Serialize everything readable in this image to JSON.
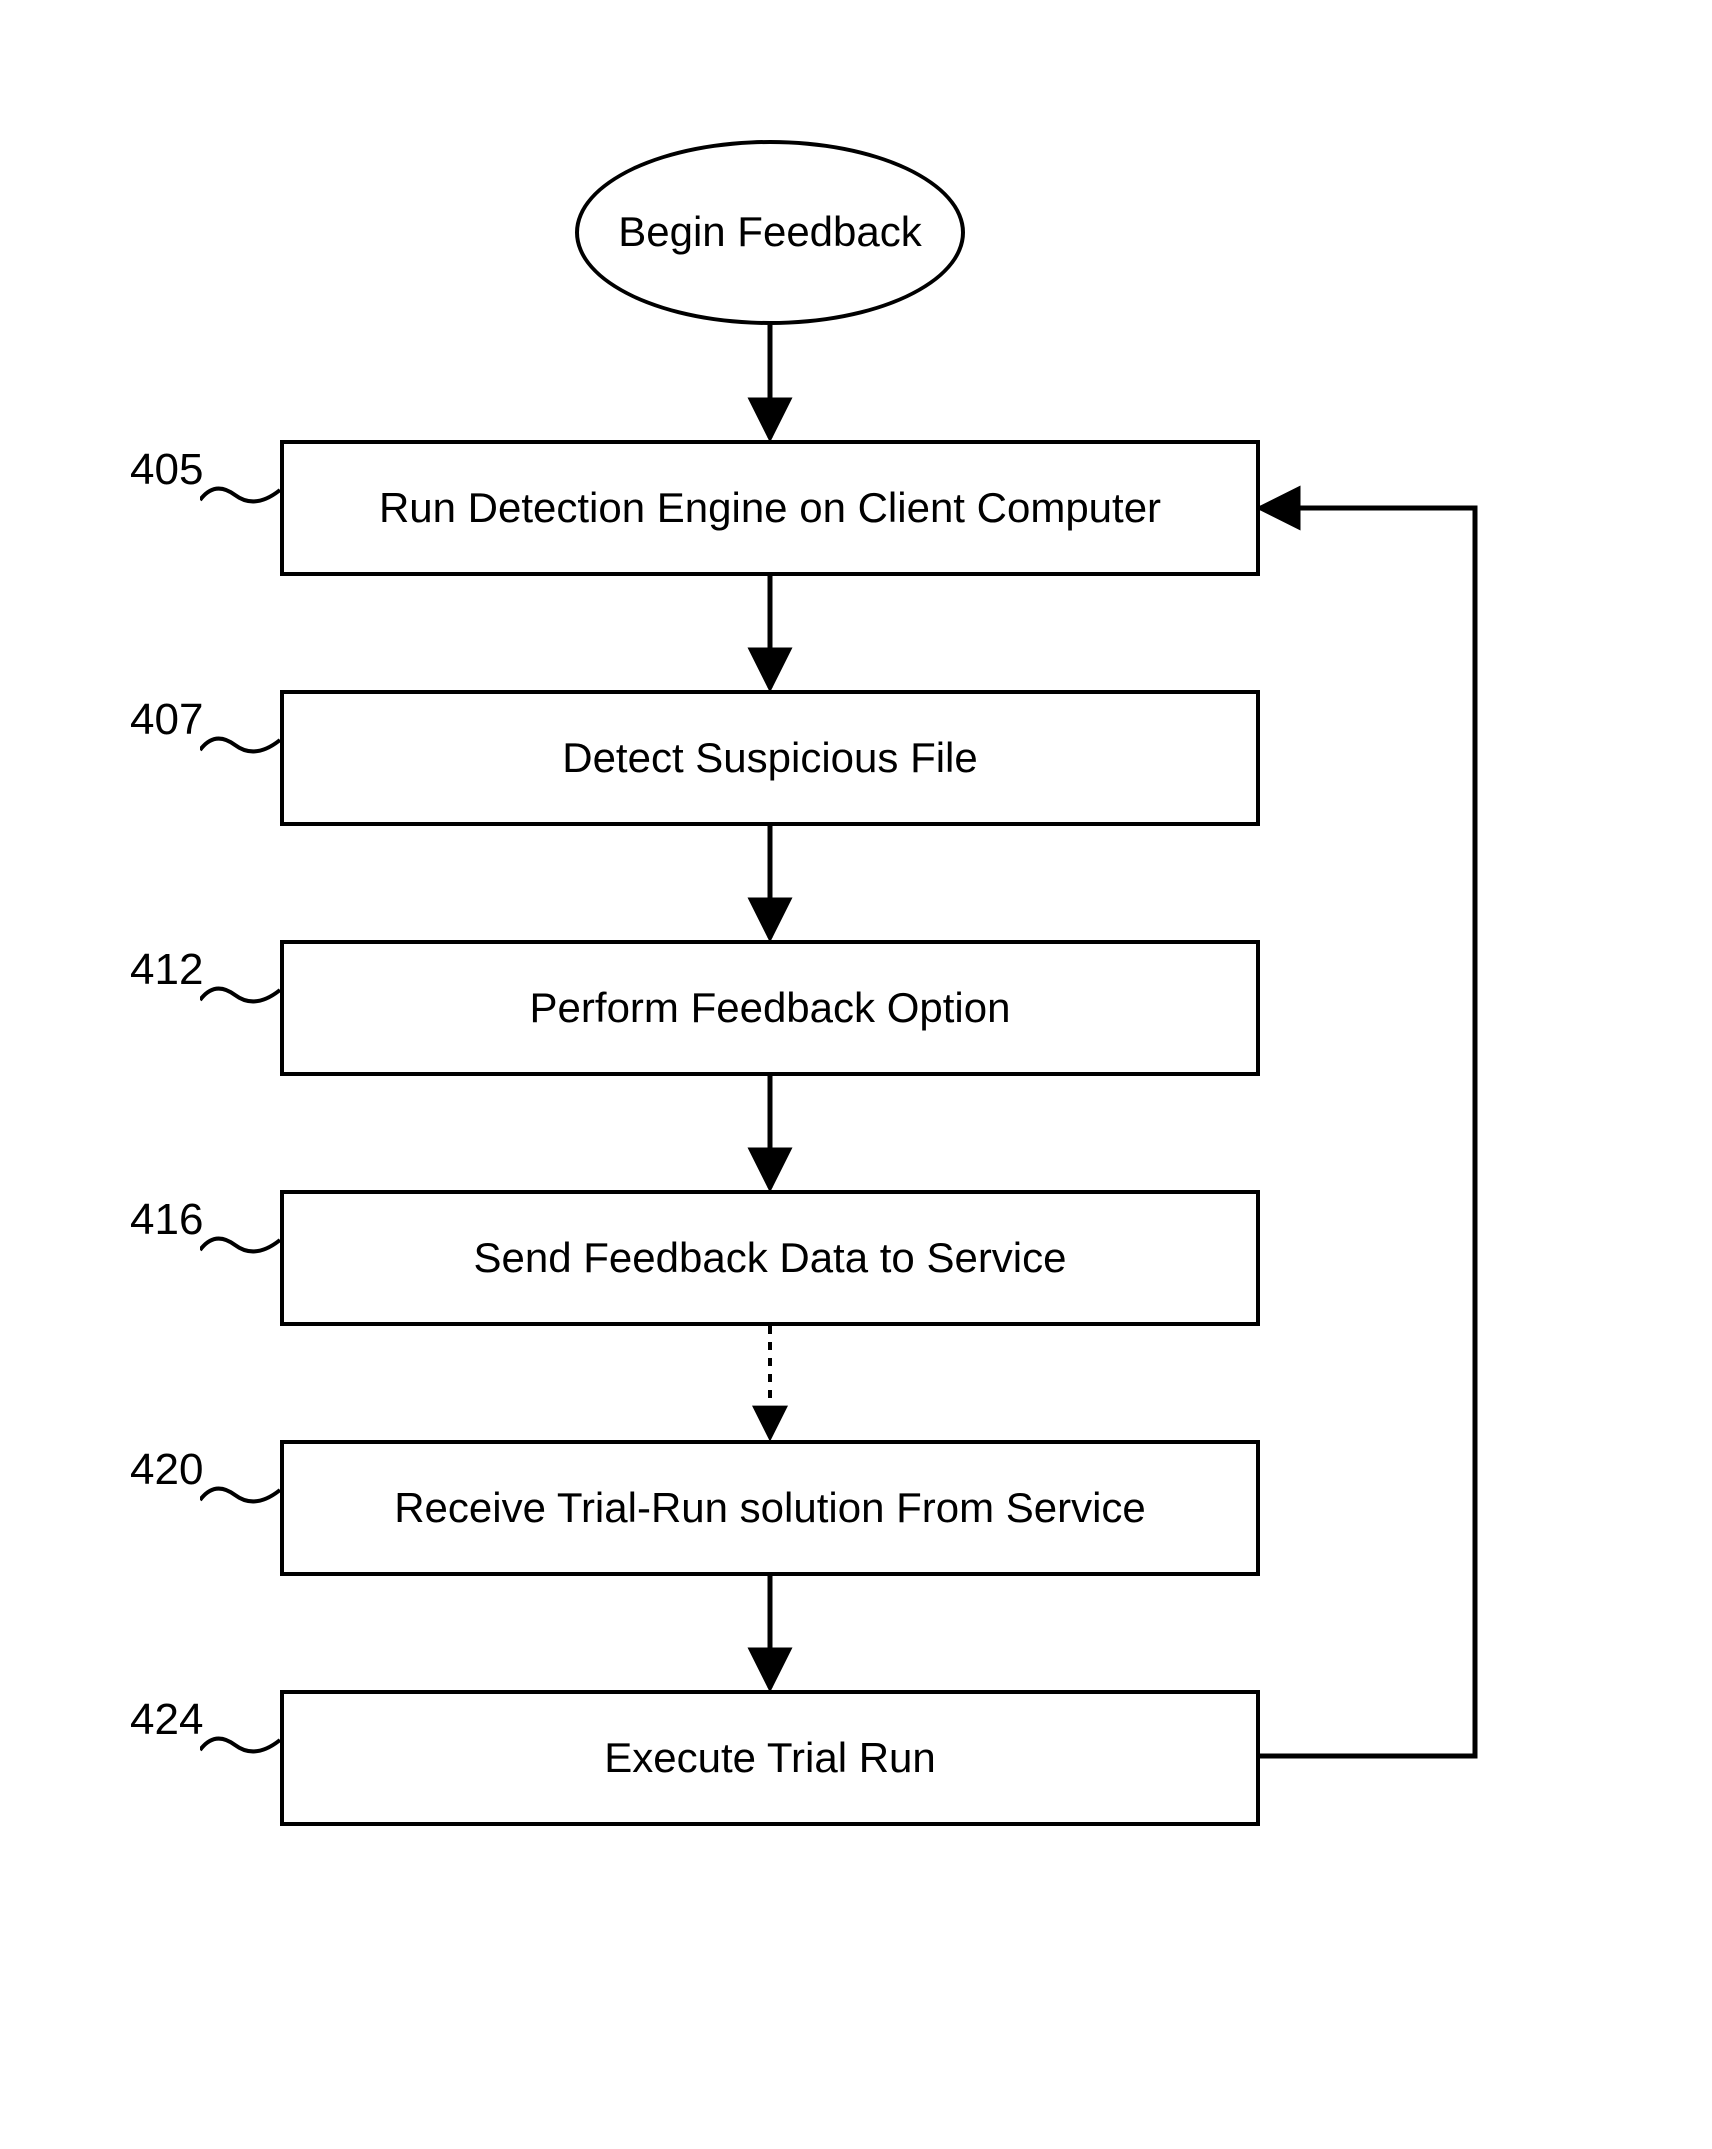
{
  "chart_data": {
    "type": "flowchart",
    "title": "",
    "nodes": [
      {
        "id": "start",
        "shape": "ellipse",
        "label": "Begin Feedback"
      },
      {
        "id": "n405",
        "shape": "rect",
        "label": "Run Detection Engine on Client Computer",
        "ref": "405"
      },
      {
        "id": "n407",
        "shape": "rect",
        "label": "Detect Suspicious File",
        "ref": "407"
      },
      {
        "id": "n412",
        "shape": "rect",
        "label": "Perform Feedback Option",
        "ref": "412"
      },
      {
        "id": "n416",
        "shape": "rect",
        "label": "Send Feedback Data to Service",
        "ref": "416"
      },
      {
        "id": "n420",
        "shape": "rect",
        "label": "Receive Trial-Run solution From Service",
        "ref": "420"
      },
      {
        "id": "n424",
        "shape": "rect",
        "label": "Execute Trial Run",
        "ref": "424"
      }
    ],
    "edges": [
      {
        "from": "start",
        "to": "n405",
        "style": "solid"
      },
      {
        "from": "n405",
        "to": "n407",
        "style": "solid"
      },
      {
        "from": "n407",
        "to": "n412",
        "style": "solid"
      },
      {
        "from": "n412",
        "to": "n416",
        "style": "solid"
      },
      {
        "from": "n416",
        "to": "n420",
        "style": "dashed"
      },
      {
        "from": "n420",
        "to": "n424",
        "style": "solid"
      },
      {
        "from": "n424",
        "to": "n405",
        "style": "solid",
        "note": "loop-back"
      }
    ]
  },
  "diagram": {
    "start_label": "Begin Feedback",
    "steps": {
      "s405": {
        "ref": "405",
        "text": "Run Detection Engine on Client Computer"
      },
      "s407": {
        "ref": "407",
        "text": "Detect Suspicious File"
      },
      "s412": {
        "ref": "412",
        "text": "Perform Feedback Option"
      },
      "s416": {
        "ref": "416",
        "text": "Send Feedback Data to Service"
      },
      "s420": {
        "ref": "420",
        "text": "Receive Trial-Run solution From Service"
      },
      "s424": {
        "ref": "424",
        "text": "Execute Trial Run"
      }
    }
  },
  "colors": {
    "stroke": "#000000",
    "background": "#ffffff"
  }
}
